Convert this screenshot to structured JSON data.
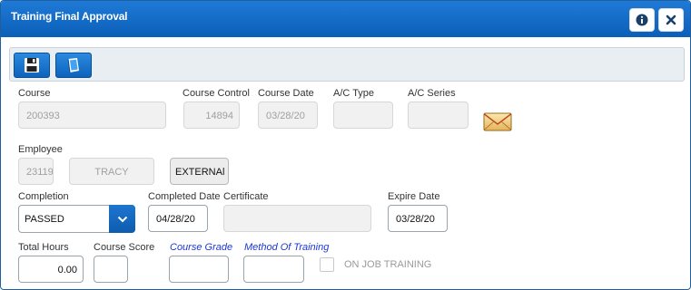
{
  "window": {
    "title": "Training Final Approval"
  },
  "titlebar": {
    "info_icon": "info-icon",
    "close_icon": "close-icon"
  },
  "toolbar": {
    "save_icon": "save-icon",
    "book_icon": "book-icon"
  },
  "form": {
    "course": {
      "label": "Course",
      "value": "200393"
    },
    "course_control": {
      "label": "Course Control",
      "value": "14894"
    },
    "course_date": {
      "label": "Course Date",
      "value": "03/28/20"
    },
    "ac_type": {
      "label": "A/C Type",
      "value": ""
    },
    "ac_series": {
      "label": "A/C Series",
      "value": ""
    },
    "employee": {
      "label": "Employee",
      "value": "23119",
      "name": "TRACY",
      "type_button": "EXTERNAl"
    },
    "completion": {
      "label": "Completion",
      "value": "PASSED"
    },
    "completed_date": {
      "label": "Completed Date",
      "value": "04/28/20"
    },
    "certificate": {
      "label": "Certificate",
      "value": ""
    },
    "expire_date": {
      "label": "Expire Date",
      "value": "03/28/20"
    },
    "total_hours": {
      "label": "Total Hours",
      "value": "0.00"
    },
    "course_score": {
      "label": "Course Score",
      "value": ""
    },
    "course_grade": {
      "label": "Course Grade",
      "value": ""
    },
    "method_of_training": {
      "label": "Method Of Training",
      "value": ""
    },
    "on_job_training": {
      "label": "ON JOB TRAINING",
      "checked": false
    }
  },
  "colors": {
    "title_bar": "#0b5fb8",
    "accent": "#1e76cf",
    "link_label": "#1d37d6"
  }
}
